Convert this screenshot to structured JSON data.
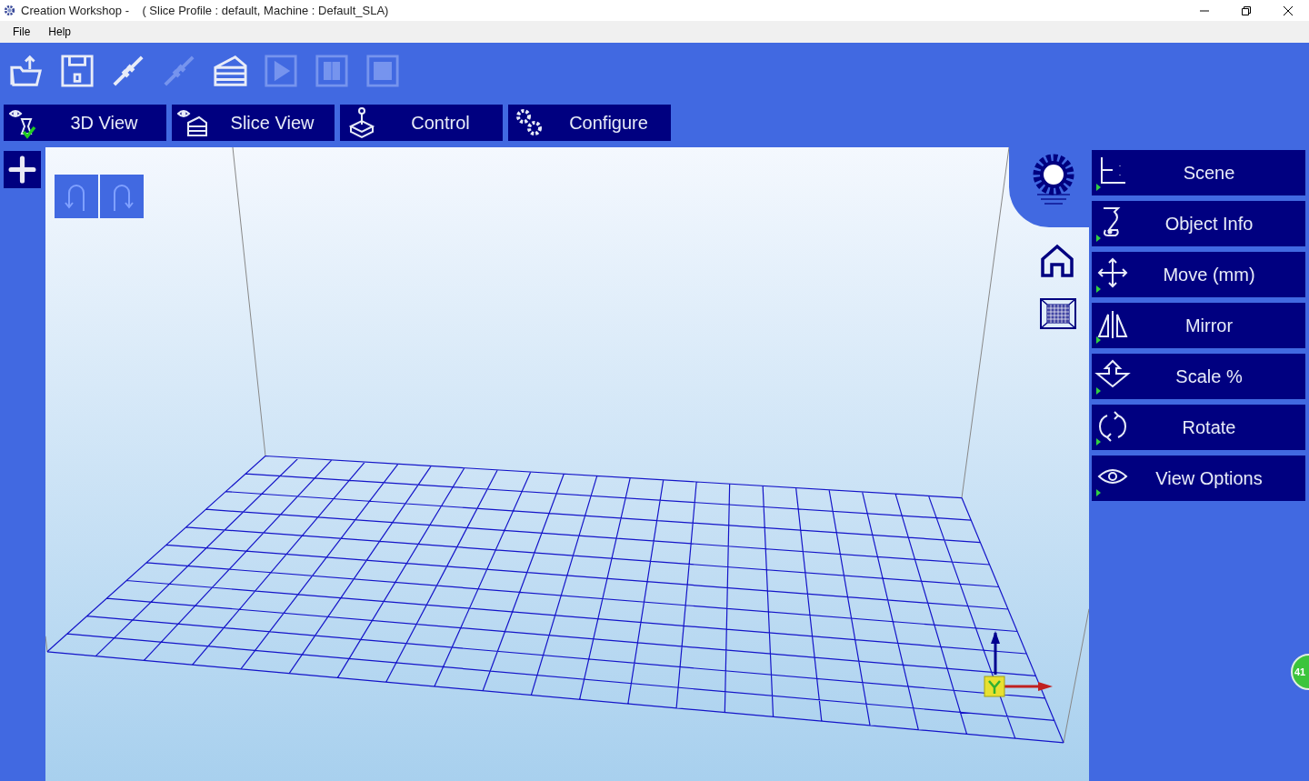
{
  "window": {
    "title": "Creation Workshop -    ( Slice Profile : default, Machine : Default_SLA)"
  },
  "menu": [
    "File",
    "Help"
  ],
  "toolbar": [
    {
      "kind": "open",
      "disabled": false
    },
    {
      "kind": "save",
      "disabled": false
    },
    {
      "kind": "connect",
      "disabled": false
    },
    {
      "kind": "disconnect",
      "disabled": true
    },
    {
      "kind": "slice",
      "disabled": false
    },
    {
      "kind": "play",
      "disabled": true
    },
    {
      "kind": "pause",
      "disabled": true
    },
    {
      "kind": "stop",
      "disabled": true
    }
  ],
  "tabs": [
    {
      "label": "3D View",
      "kind": "view3d"
    },
    {
      "label": "Slice View",
      "kind": "slice"
    },
    {
      "label": "Control",
      "kind": "control"
    },
    {
      "label": "Configure",
      "kind": "configure"
    }
  ],
  "panels": [
    {
      "label": "Scene",
      "kind": "scene"
    },
    {
      "label": "Object Info",
      "kind": "info"
    },
    {
      "label": "Move (mm)",
      "kind": "move"
    },
    {
      "label": "Mirror",
      "kind": "mirror"
    },
    {
      "label": "Scale %",
      "kind": "scale"
    },
    {
      "label": "Rotate",
      "kind": "rotate"
    },
    {
      "label": "View Options",
      "kind": "eye"
    }
  ],
  "badge": "41"
}
